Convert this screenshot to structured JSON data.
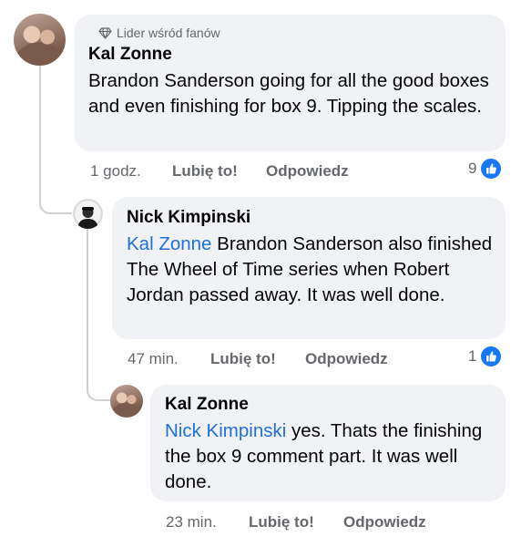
{
  "comments": [
    {
      "author": "Kal Zonne",
      "badge": "Lider wśród fanów",
      "mention": "",
      "text": "Brandon Sanderson going for all the good boxes and even finishing for box 9. Tipping the scales.",
      "time": "1 godz.",
      "like_label": "Lubię to!",
      "reply_label": "Odpowiedz",
      "reaction_count": "9"
    },
    {
      "author": "Nick Kimpinski",
      "mention": "Kal Zonne",
      "text": "Brandon Sanderson also finished The Wheel of Time series when Robert Jordan passed away. It was well done.",
      "time": "47 min.",
      "like_label": "Lubię to!",
      "reply_label": "Odpowiedz",
      "reaction_count": "1"
    },
    {
      "author": "Kal Zonne",
      "mention": "Nick Kimpinski",
      "text": "yes. Thats the finishing the box 9 comment part. It was well done.",
      "time": "23 min.",
      "like_label": "Lubię to!",
      "reply_label": "Odpowiedz"
    }
  ],
  "icons": {
    "badge": "diamond-icon",
    "reaction": "thumbs-up-icon"
  },
  "colors": {
    "bubble": "#f0f2f5",
    "mention": "#216fdb",
    "like_blue": "#1877f2",
    "meta_gray": "#65676b"
  }
}
